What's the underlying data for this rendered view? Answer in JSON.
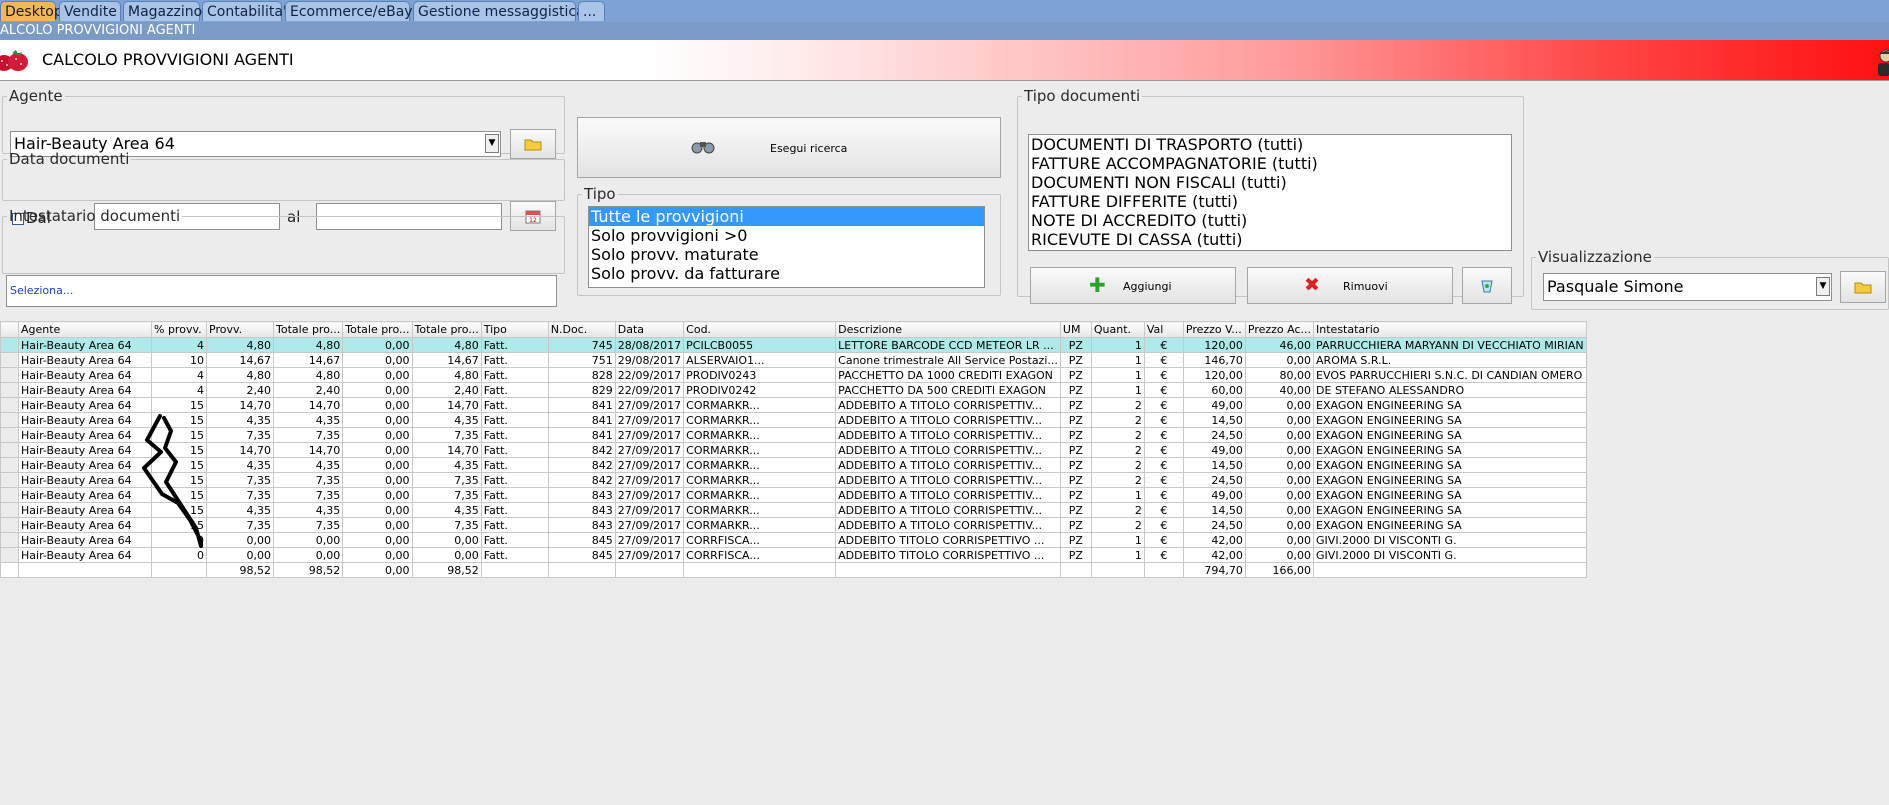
{
  "tabs": [
    {
      "label": "Desktop",
      "active": true
    },
    {
      "label": "Vendite",
      "active": false
    },
    {
      "label": "Magazzino",
      "active": false
    },
    {
      "label": "Contabilita'",
      "active": false
    },
    {
      "label": "Ecommerce/eBay",
      "active": false
    },
    {
      "label": "Gestione messaggistica",
      "active": false
    },
    {
      "label": "...",
      "active": false
    }
  ],
  "window_title": "ALCOLO PROVVIGIONI AGENTI",
  "header": {
    "title": "CALCOLO PROVVIGIONI AGENTI",
    "logo_icon": "strawberry-icon",
    "avatar_icon": "user-avatar-icon"
  },
  "agente": {
    "legend": "Agente",
    "value": "Hair-Beauty Area 64"
  },
  "data_documenti": {
    "legend": "Data documenti",
    "dal_label": "Dal",
    "al_label": "al",
    "dal_value": "",
    "al_value": ""
  },
  "intestatario": {
    "legend": "Intestatario documenti",
    "value": "Seleziona..."
  },
  "search_button": {
    "label": "Esegui ricerca"
  },
  "tipo": {
    "legend": "Tipo",
    "items": [
      "Tutte le provvigioni",
      "Solo provvigioni >0",
      "Solo provv. maturate",
      "Solo provv. da fatturare"
    ],
    "selected_index": 0
  },
  "tipo_documenti": {
    "legend": "Tipo documenti",
    "items": [
      "DOCUMENTI DI TRASPORTO (tutti)",
      "FATTURE ACCOMPAGNATORIE (tutti)",
      "DOCUMENTI NON FISCALI (tutti)",
      "FATTURE DIFFERITE (tutti)",
      "NOTE DI ACCREDITO (tutti)",
      "RICEVUTE DI CASSA (tutti)"
    ]
  },
  "aggiungi_label": "Aggiungi",
  "rimuovi_label": "Rimuovi",
  "visualizzazione": {
    "legend": "Visualizzazione",
    "value": "Pasquale Simone"
  },
  "colors": {
    "accent_red": "#ff1010",
    "tab_active": "#f3b75a",
    "tab_bar": "#7ea2d4",
    "selected_row": "#aeeaea",
    "list_selection": "#3399ff"
  },
  "grid": {
    "columns": [
      "Agente",
      "% provv.",
      "Provv.",
      "Totale pro...",
      "Totale pro...",
      "Totale pro...",
      "Tipo",
      "N.Doc.",
      "Data",
      "Cod.",
      "Descrizione",
      "UM",
      "Quant.",
      "Val",
      "Prezzo V...",
      "Prezzo Ac...",
      "Intestatario"
    ],
    "rows": [
      [
        "Hair-Beauty Area 64",
        "4",
        "4,80",
        "4,80",
        "0,00",
        "4,80",
        "Fatt.",
        "745",
        "28/08/2017",
        "PCILCB0055",
        "LETTORE BARCODE CCD METEOR LR ...",
        "PZ",
        "1",
        "€",
        "120,00",
        "46,00",
        "PARRUCCHIERA MARYANN DI VECCHIATO MIRIAN"
      ],
      [
        "Hair-Beauty Area 64",
        "10",
        "14,67",
        "14,67",
        "0,00",
        "14,67",
        "Fatt.",
        "751",
        "29/08/2017",
        "ALSERVAIO1...",
        "Canone trimestrale All Service Postazi...",
        "PZ",
        "1",
        "€",
        "146,70",
        "0,00",
        "AROMA S.R.L."
      ],
      [
        "Hair-Beauty Area 64",
        "4",
        "4,80",
        "4,80",
        "0,00",
        "4,80",
        "Fatt.",
        "828",
        "22/09/2017",
        "PRODIV0243",
        "PACCHETTO DA 1000 CREDITI EXAGON",
        "PZ",
        "1",
        "€",
        "120,00",
        "80,00",
        "EVOS PARRUCCHIERI S.N.C. DI CANDIAN OMERO"
      ],
      [
        "Hair-Beauty Area 64",
        "4",
        "2,40",
        "2,40",
        "0,00",
        "2,40",
        "Fatt.",
        "829",
        "22/09/2017",
        "PRODIV0242",
        "PACCHETTO DA 500 CREDITI EXAGON",
        "PZ",
        "1",
        "€",
        "60,00",
        "40,00",
        "DE STEFANO ALESSANDRO"
      ],
      [
        "Hair-Beauty Area 64",
        "15",
        "14,70",
        "14,70",
        "0,00",
        "14,70",
        "Fatt.",
        "841",
        "27/09/2017",
        "CORMARKR...",
        "ADDEBITO A TITOLO CORRISPETTIV...",
        "PZ",
        "2",
        "€",
        "49,00",
        "0,00",
        "EXAGON ENGINEERING SA"
      ],
      [
        "Hair-Beauty Area 64",
        "15",
        "4,35",
        "4,35",
        "0,00",
        "4,35",
        "Fatt.",
        "841",
        "27/09/2017",
        "CORMARKR...",
        "ADDEBITO A TITOLO CORRISPETTIV...",
        "PZ",
        "2",
        "€",
        "14,50",
        "0,00",
        "EXAGON ENGINEERING SA"
      ],
      [
        "Hair-Beauty Area 64",
        "15",
        "7,35",
        "7,35",
        "0,00",
        "7,35",
        "Fatt.",
        "841",
        "27/09/2017",
        "CORMARKR...",
        "ADDEBITO A TITOLO CORRISPETTIV...",
        "PZ",
        "2",
        "€",
        "24,50",
        "0,00",
        "EXAGON ENGINEERING SA"
      ],
      [
        "Hair-Beauty Area 64",
        "15",
        "14,70",
        "14,70",
        "0,00",
        "14,70",
        "Fatt.",
        "842",
        "27/09/2017",
        "CORMARKR...",
        "ADDEBITO A TITOLO CORRISPETTIV...",
        "PZ",
        "2",
        "€",
        "49,00",
        "0,00",
        "EXAGON ENGINEERING SA"
      ],
      [
        "Hair-Beauty Area 64",
        "15",
        "4,35",
        "4,35",
        "0,00",
        "4,35",
        "Fatt.",
        "842",
        "27/09/2017",
        "CORMARKR...",
        "ADDEBITO A TITOLO CORRISPETTIV...",
        "PZ",
        "2",
        "€",
        "14,50",
        "0,00",
        "EXAGON ENGINEERING SA"
      ],
      [
        "Hair-Beauty Area 64",
        "15",
        "7,35",
        "7,35",
        "0,00",
        "7,35",
        "Fatt.",
        "842",
        "27/09/2017",
        "CORMARKR...",
        "ADDEBITO A TITOLO CORRISPETTIV...",
        "PZ",
        "2",
        "€",
        "24,50",
        "0,00",
        "EXAGON ENGINEERING SA"
      ],
      [
        "Hair-Beauty Area 64",
        "15",
        "7,35",
        "7,35",
        "0,00",
        "7,35",
        "Fatt.",
        "843",
        "27/09/2017",
        "CORMARKR...",
        "ADDEBITO A TITOLO CORRISPETTIV...",
        "PZ",
        "1",
        "€",
        "49,00",
        "0,00",
        "EXAGON ENGINEERING SA"
      ],
      [
        "Hair-Beauty Area 64",
        "15",
        "4,35",
        "4,35",
        "0,00",
        "4,35",
        "Fatt.",
        "843",
        "27/09/2017",
        "CORMARKR...",
        "ADDEBITO A TITOLO CORRISPETTIV...",
        "PZ",
        "2",
        "€",
        "14,50",
        "0,00",
        "EXAGON ENGINEERING SA"
      ],
      [
        "Hair-Beauty Area 64",
        "15",
        "7,35",
        "7,35",
        "0,00",
        "7,35",
        "Fatt.",
        "843",
        "27/09/2017",
        "CORMARKR...",
        "ADDEBITO A TITOLO CORRISPETTIV...",
        "PZ",
        "2",
        "€",
        "24,50",
        "0,00",
        "EXAGON ENGINEERING SA"
      ],
      [
        "Hair-Beauty Area 64",
        "0",
        "0,00",
        "0,00",
        "0,00",
        "0,00",
        "Fatt.",
        "845",
        "27/09/2017",
        "CORRFISCA...",
        "ADDEBITO TITOLO CORRISPETTIVO ...",
        "PZ",
        "1",
        "€",
        "42,00",
        "0,00",
        "GIVI.2000 DI VISCONTI G."
      ],
      [
        "Hair-Beauty Area 64",
        "0",
        "0,00",
        "0,00",
        "0,00",
        "0,00",
        "Fatt.",
        "845",
        "27/09/2017",
        "CORRFISCA...",
        "ADDEBITO TITOLO CORRISPETTIVO ...",
        "PZ",
        "1",
        "€",
        "42,00",
        "0,00",
        "GIVI.2000 DI VISCONTI G."
      ]
    ],
    "totals": [
      "",
      "",
      "98,52",
      "98,52",
      "0,00",
      "98,52",
      "",
      "",
      "",
      "",
      "",
      "",
      "",
      "",
      "794,70",
      "166,00",
      ""
    ]
  }
}
